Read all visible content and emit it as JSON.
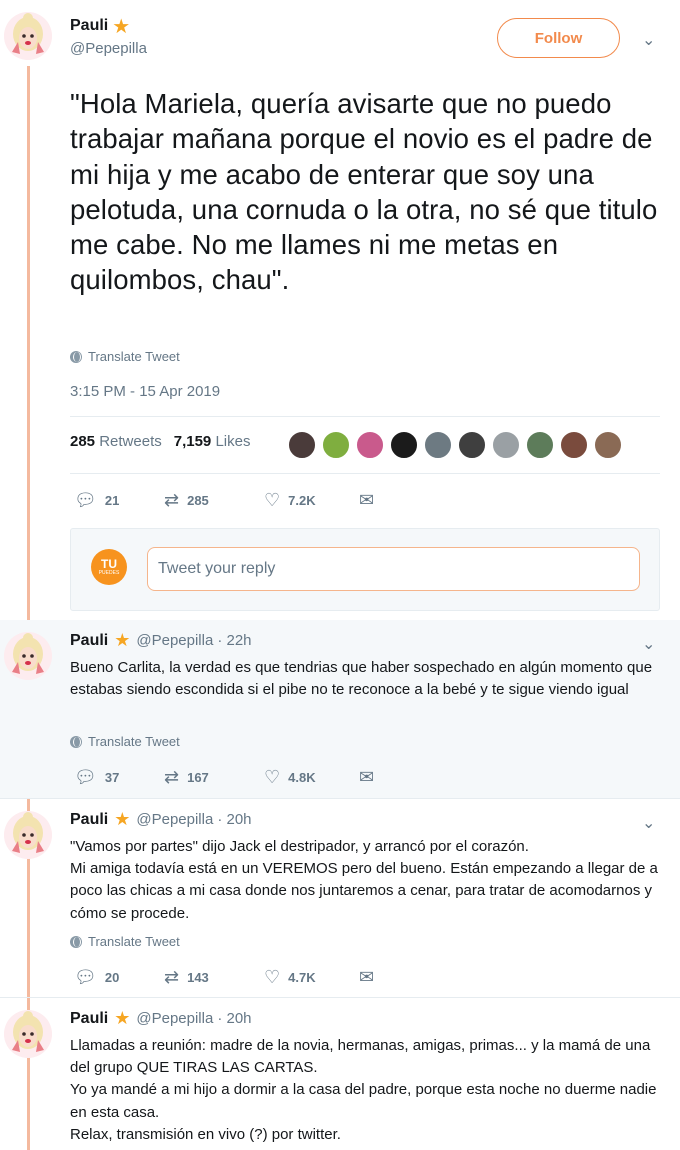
{
  "main_tweet": {
    "name": "Pauli",
    "handle": "@Pepepilla",
    "follow_label": "Follow",
    "text": "\"Hola Mariela, quería avisarte que no puedo trabajar mañana porque el novio es el padre de mi hija y me acabo de enterar que soy una pelotuda, una cornuda o la otra, no sé que titulo me cabe. No me llames ni me metas en quilombos, chau\".",
    "translate": "Translate Tweet",
    "timestamp": "3:15 PM - 15 Apr 2019",
    "retweets_count": "285",
    "retweets_label": "Retweets",
    "likes_count": "7,159",
    "likes_label": "Likes",
    "liker_colors": [
      "#4a3b3a",
      "#7fae3f",
      "#c95a8c",
      "#1b1b1b",
      "#6d7a82",
      "#3f3f3f",
      "#9aa0a4",
      "#5d7c5a",
      "#7a4b3d",
      "#8a6a55"
    ],
    "actions": {
      "replies": "21",
      "retweets": "285",
      "likes": "7.2K"
    },
    "reply_placeholder": "Tweet your reply",
    "reply_avatar": {
      "line1": "TU",
      "line2": "PUEDES"
    }
  },
  "replies": [
    {
      "name": "Pauli",
      "handle": "@Pepepilla",
      "time": "· 22h",
      "text": "Bueno Carlita, la verdad es que tendrias que haber sospechado en algún momento que estabas siendo escondida si el pibe no te reconoce a la bebé y te sigue viendo igual",
      "translate": "Translate Tweet",
      "actions": {
        "replies": "37",
        "retweets": "167",
        "likes": "4.8K"
      }
    },
    {
      "name": "Pauli",
      "handle": "@Pepepilla",
      "time": "· 20h",
      "text_lines": [
        "\"Vamos por partes\" dijo Jack el destripador, y arrancó por el corazón.",
        "Mi amiga todavía está en un VEREMOS pero del bueno. Están empezando a llegar de a poco las chicas a mi casa donde nos juntaremos a cenar, para tratar de acomodarnos y cómo se procede."
      ],
      "translate": "Translate Tweet",
      "actions": {
        "replies": "20",
        "retweets": "143",
        "likes": "4.7K"
      }
    },
    {
      "name": "Pauli",
      "handle": "@Pepepilla",
      "time": "· 20h",
      "text_lines": [
        "Llamadas a reunión: madre de la novia, hermanas, amigas, primas... y la mamá de una del grupo QUE TIRAS LAS CARTAS.",
        "Yo ya mandé a mi hijo a dormir a la casa del padre, porque esta noche no duerme nadie en esta casa.",
        "Relax, transmisión en vivo (?) por twitter."
      ]
    }
  ],
  "colors": {
    "accent": "#f28a4c",
    "thread": "#f4b99e",
    "star": "#f6a623",
    "muted": "#657786"
  },
  "icons": {
    "reply": "reply-icon",
    "retweet": "retweet-icon",
    "like": "heart-icon",
    "dm": "envelope-icon",
    "more": "chevron-down-icon",
    "translate": "globe-icon"
  }
}
